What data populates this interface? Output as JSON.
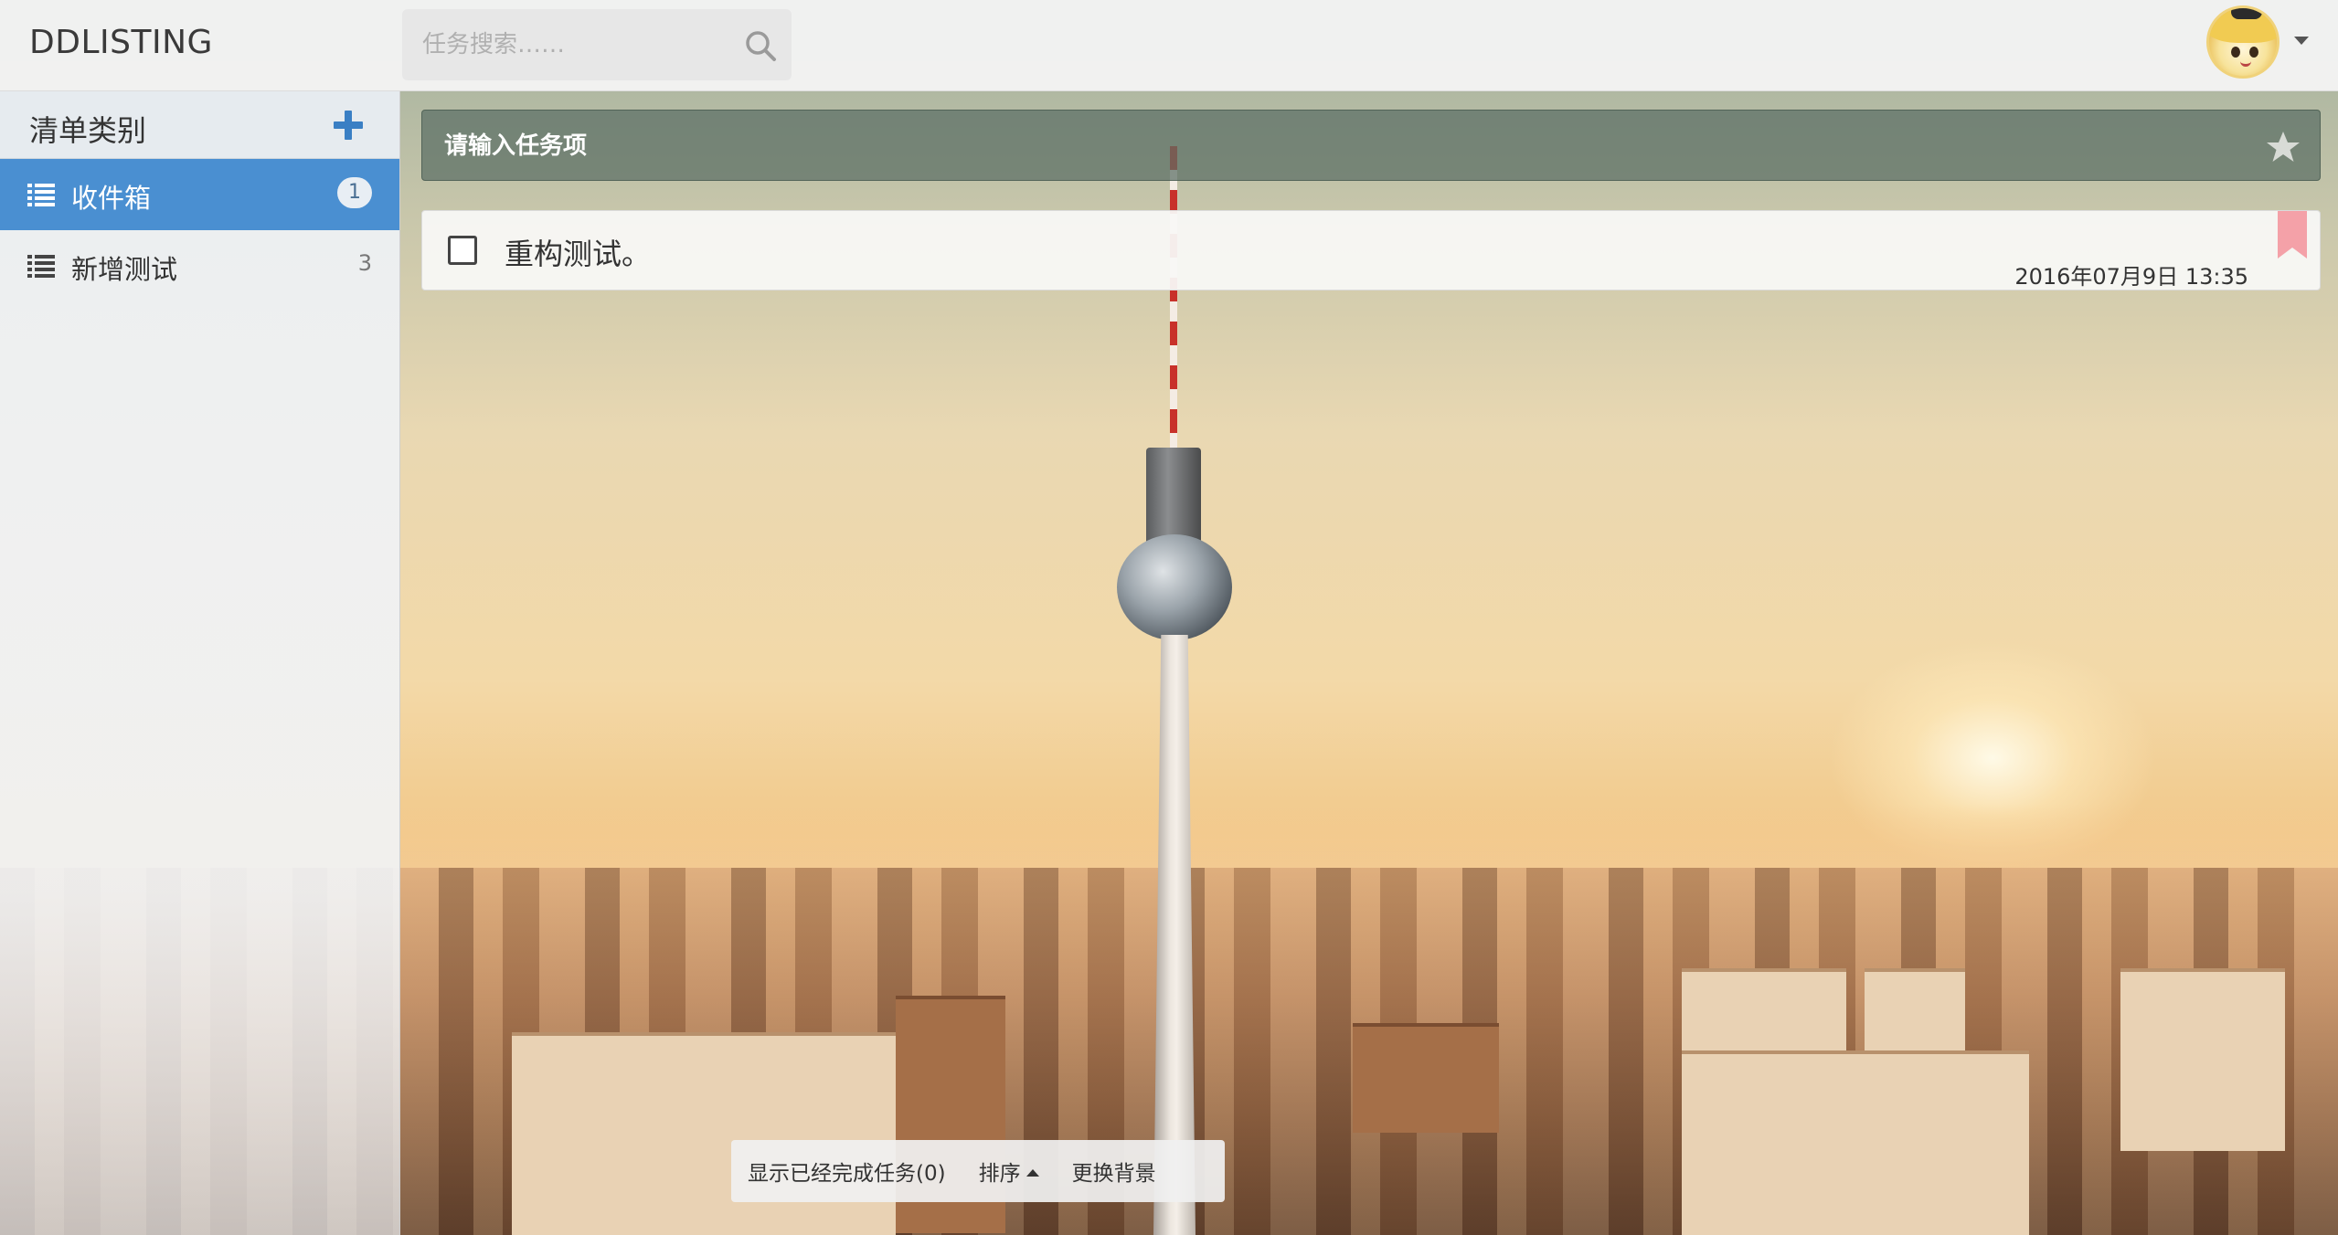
{
  "app": {
    "brand": "DDLISTING"
  },
  "search": {
    "placeholder": "任务搜索……"
  },
  "sidebar": {
    "title": "清单类别",
    "items": [
      {
        "label": "收件箱",
        "count": "1",
        "active": true
      },
      {
        "label": "新增测试",
        "count": "3",
        "active": false
      }
    ]
  },
  "task_input": {
    "placeholder": "请输入任务项"
  },
  "tasks": [
    {
      "text": "重构测试。",
      "date": "2016年07月9日 13:35",
      "done": false
    }
  ],
  "bottom_bar": {
    "show_completed": "显示已经完成任务(0)",
    "sort": "排序",
    "change_background": "更换背景"
  },
  "colors": {
    "accent": "#4a8fd1",
    "flag": "#f4a1a8",
    "add_icon": "#3a7fc4"
  }
}
